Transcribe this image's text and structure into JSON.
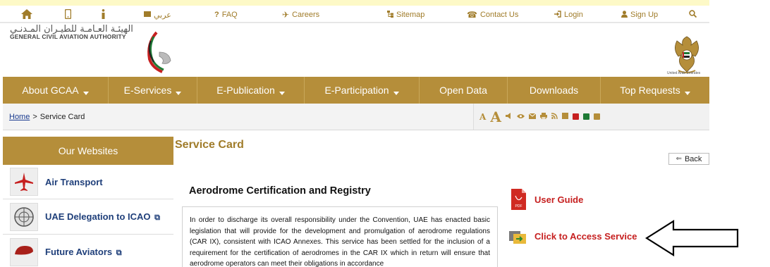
{
  "topbar": {
    "items": [
      {
        "label": "",
        "icon": "home-icon"
      },
      {
        "label": "",
        "icon": "mobile-icon"
      },
      {
        "label": "",
        "icon": "info-icon"
      },
      {
        "label": "عربي",
        "icon": "language-icon"
      },
      {
        "label": "FAQ",
        "icon": "question-icon"
      },
      {
        "label": "Careers",
        "icon": "plane-icon"
      },
      {
        "label": "Sitemap",
        "icon": "sitemap-icon"
      },
      {
        "label": "Contact Us",
        "icon": "phone-icon"
      },
      {
        "label": "Login",
        "icon": "login-icon"
      },
      {
        "label": "Sign Up",
        "icon": "user-icon"
      },
      {
        "label": "",
        "icon": "search-icon"
      }
    ]
  },
  "header": {
    "logo_arabic": "الهيئـة العـامـة للطيـران المـدنـي",
    "logo_english": "GENERAL CIVIL AVIATION AUTHORITY",
    "emblem_caption": "United Arab Emirates"
  },
  "nav": {
    "items": [
      {
        "label": "About GCAA",
        "has_dropdown": true
      },
      {
        "label": "E-Services",
        "has_dropdown": true
      },
      {
        "label": "E-Publication",
        "has_dropdown": true
      },
      {
        "label": "E-Participation",
        "has_dropdown": true
      },
      {
        "label": "Open Data",
        "has_dropdown": false
      },
      {
        "label": "Downloads",
        "has_dropdown": false
      },
      {
        "label": "Top Requests",
        "has_dropdown": true
      }
    ]
  },
  "breadcrumb": {
    "home": "Home",
    "separator": ">",
    "current": "Service Card"
  },
  "tools": {
    "font_small": "A",
    "font_large": "A",
    "colors": [
      "#c62020",
      "#1e7a35",
      "#b58e3a"
    ]
  },
  "sidebar": {
    "title": "Our Websites",
    "items": [
      {
        "label": "Air Transport",
        "external": false
      },
      {
        "label": "UAE Delegation to ICAO",
        "external": true
      },
      {
        "label": "Future Aviators",
        "external": true
      }
    ]
  },
  "content": {
    "page_title": "Service Card",
    "back_label": "Back",
    "service_title": "Aerodrome Certification and Registry",
    "description": "In order to discharge its overall responsibility under the Convention, UAE has enacted basic legislation that will provide for the development and promulgation of aerodrome regulations (CAR IX), consistent with ICAO Annexes. This service has been settled for the inclusion of a requirement for the certification of aerodromes in the CAR IX which in return will ensure that aerodrome operators can meet their obligations in accordance",
    "user_guide_label": "User Guide",
    "access_service_label": "Click to Access Service"
  }
}
